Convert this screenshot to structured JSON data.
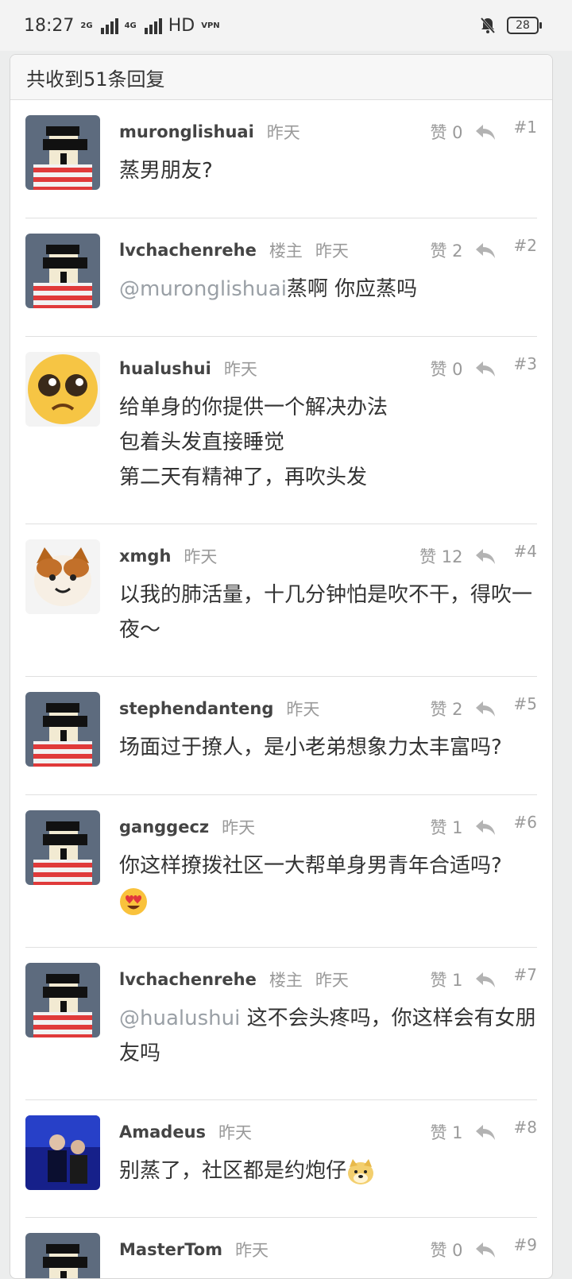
{
  "status_bar": {
    "time": "18:27",
    "network_1": "2G",
    "network_2": "4G",
    "hd_label": "HD",
    "vpn_label": "VPN",
    "battery": "28"
  },
  "header": {
    "title": "共收到51条回复"
  },
  "comments": [
    {
      "username": "muronglishuai",
      "tag": "",
      "time": "昨天",
      "likes": "赞 0",
      "floor": "#1",
      "mention": "",
      "text": "蒸男朋友?",
      "avatar": "pixel-avatar"
    },
    {
      "username": "lvchachenrehe",
      "tag": "楼主",
      "time": "昨天",
      "likes": "赞 2",
      "floor": "#2",
      "mention": "@muronglishuai",
      "text": "蒸啊 你应蒸吗",
      "avatar": "pixel-avatar"
    },
    {
      "username": "hualushui",
      "tag": "",
      "time": "昨天",
      "likes": "赞 0",
      "floor": "#3",
      "mention": "",
      "text": "给单身的你提供一个解决办法\n包着头发直接睡觉\n第二天有精神了，再吹头发",
      "avatar": "sad-emoji-avatar"
    },
    {
      "username": "xmgh",
      "tag": "",
      "time": "昨天",
      "likes": "赞 12",
      "floor": "#4",
      "mention": "",
      "text": "以我的肺活量，十几分钟怕是吹不干，得吹一夜～",
      "avatar": "cat-avatar"
    },
    {
      "username": "stephendanteng",
      "tag": "",
      "time": "昨天",
      "likes": "赞 2",
      "floor": "#5",
      "mention": "",
      "text": "场面过于撩人，是小老弟想象力太丰富吗?",
      "avatar": "pixel-avatar"
    },
    {
      "username": "ganggecz",
      "tag": "",
      "time": "昨天",
      "likes": "赞 1",
      "floor": "#6",
      "mention": "",
      "text": "你这样撩拨社区一大帮单身男青年合适吗?",
      "avatar": "pixel-avatar",
      "emoji": "heart-eyes-emoji"
    },
    {
      "username": "lvchachenrehe",
      "tag": "楼主",
      "time": "昨天",
      "likes": "赞 1",
      "floor": "#7",
      "mention": "@hualushui",
      "text": " 这不会头疼吗，你这样会有女朋友吗",
      "avatar": "pixel-avatar"
    },
    {
      "username": "Amadeus",
      "tag": "",
      "time": "昨天",
      "likes": "赞 1",
      "floor": "#8",
      "mention": "",
      "text": "别蒸了，社区都是约炮仔",
      "avatar": "photo-avatar",
      "emoji": "doge-emoji"
    },
    {
      "username": "MasterTom",
      "tag": "",
      "time": "昨天",
      "likes": "赞 0",
      "floor": "#9",
      "mention": "",
      "text": "",
      "avatar": "pixel-avatar"
    }
  ],
  "colors": {
    "accent_gray": "#9a9a9a",
    "mention": "#9aa0a6",
    "header_bg": "#f7f7f7"
  }
}
